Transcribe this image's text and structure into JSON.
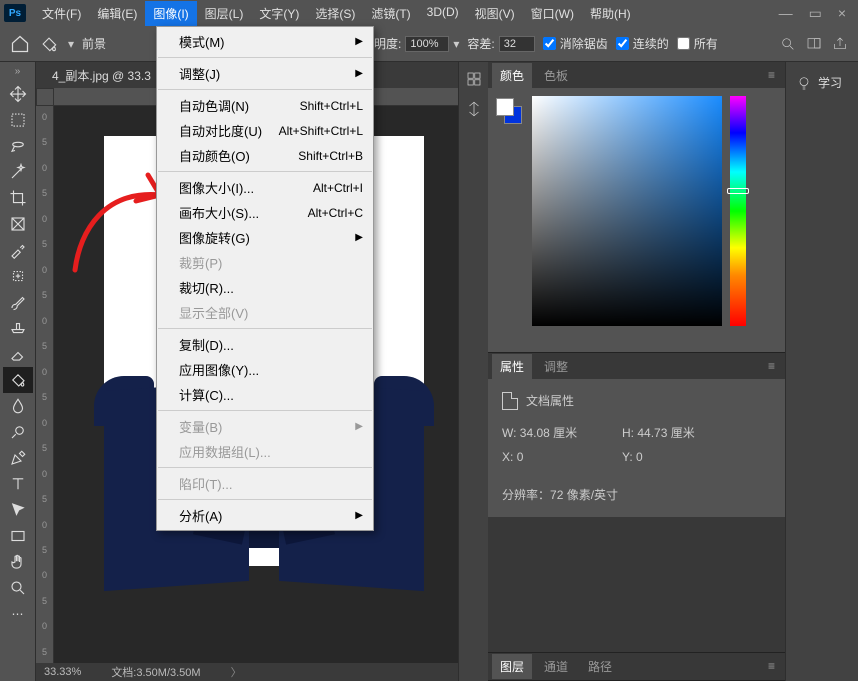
{
  "app": {
    "name": "Ps"
  },
  "menubar": [
    "文件(F)",
    "编辑(E)",
    "图像(I)",
    "图层(L)",
    "文字(Y)",
    "选择(S)",
    "滤镜(T)",
    "3D(D)",
    "视图(V)",
    "窗口(W)",
    "帮助(H)"
  ],
  "active_menu_index": 2,
  "options_bar": {
    "foreground_label": "前景",
    "opacity_label": "透明度:",
    "opacity_value": "100%",
    "tolerance_label": "容差:",
    "tolerance_value": "32",
    "antialias_label": "消除锯齿",
    "contiguous_label": "连续的",
    "all_layers_label": "所有"
  },
  "document": {
    "tab_title": "4_副本.jpg @ 33.3",
    "zoom": "33.33%",
    "doc_info": "文档:3.50M/3.50M"
  },
  "ruler_left": [
    "0",
    "5",
    "0",
    "5",
    "0",
    "5",
    "0",
    "5",
    "0",
    "5",
    "0",
    "5",
    "0",
    "5",
    "0",
    "5",
    "0",
    "5",
    "0",
    "5",
    "0",
    "5"
  ],
  "dropdown": {
    "groups": [
      [
        {
          "label": "模式(M)",
          "submenu": true
        }
      ],
      [
        {
          "label": "调整(J)",
          "submenu": true
        }
      ],
      [
        {
          "label": "自动色调(N)",
          "shortcut": "Shift+Ctrl+L"
        },
        {
          "label": "自动对比度(U)",
          "shortcut": "Alt+Shift+Ctrl+L"
        },
        {
          "label": "自动颜色(O)",
          "shortcut": "Shift+Ctrl+B"
        }
      ],
      [
        {
          "label": "图像大小(I)...",
          "shortcut": "Alt+Ctrl+I",
          "highlighted": true
        },
        {
          "label": "画布大小(S)...",
          "shortcut": "Alt+Ctrl+C"
        },
        {
          "label": "图像旋转(G)",
          "submenu": true
        },
        {
          "label": "裁剪(P)",
          "disabled": true
        },
        {
          "label": "裁切(R)..."
        },
        {
          "label": "显示全部(V)",
          "disabled": true
        }
      ],
      [
        {
          "label": "复制(D)..."
        },
        {
          "label": "应用图像(Y)..."
        },
        {
          "label": "计算(C)..."
        }
      ],
      [
        {
          "label": "变量(B)",
          "submenu": true,
          "disabled": true
        },
        {
          "label": "应用数据组(L)...",
          "disabled": true
        }
      ],
      [
        {
          "label": "陷印(T)...",
          "disabled": true
        }
      ],
      [
        {
          "label": "分析(A)",
          "submenu": true
        }
      ]
    ]
  },
  "color_panel": {
    "tabs": [
      "颜色",
      "色板"
    ],
    "active": 0
  },
  "properties_panel": {
    "tabs": [
      "属性",
      "调整"
    ],
    "active": 0,
    "title": "文档属性",
    "w_label": "W:",
    "w_value": "34.08 厘米",
    "h_label": "H:",
    "h_value": "44.73 厘米",
    "x_label": "X:",
    "x_value": "0",
    "y_label": "Y:",
    "y_value": "0",
    "res_label": "分辨率：",
    "res_value": "72 像素/英寸"
  },
  "layers_panel": {
    "tabs": [
      "图层",
      "通道",
      "路径"
    ],
    "active": 0
  },
  "rightbar": {
    "learn_label": "学习"
  }
}
